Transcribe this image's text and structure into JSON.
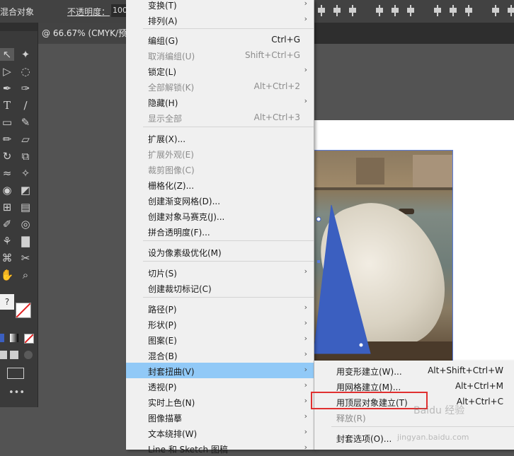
{
  "control_bar": {
    "blend_label": "混合对象",
    "opacity_label": "不透明度：",
    "opacity_value": "100"
  },
  "document_tab": {
    "title": "@ 66.67% (CMYK/预"
  },
  "object_menu": {
    "items": [
      {
        "label": "变换(T)",
        "shortcut": "",
        "submenu": true,
        "disabled": false
      },
      {
        "label": "排列(A)",
        "shortcut": "",
        "submenu": true,
        "disabled": false
      },
      {
        "label": "编组(G)",
        "shortcut": "Ctrl+G",
        "submenu": false,
        "disabled": false
      },
      {
        "label": "取消编组(U)",
        "shortcut": "Shift+Ctrl+G",
        "submenu": false,
        "disabled": true
      },
      {
        "label": "锁定(L)",
        "shortcut": "",
        "submenu": true,
        "disabled": false
      },
      {
        "label": "全部解锁(K)",
        "shortcut": "Alt+Ctrl+2",
        "submenu": false,
        "disabled": true
      },
      {
        "label": "隐藏(H)",
        "shortcut": "",
        "submenu": true,
        "disabled": false
      },
      {
        "label": "显示全部",
        "shortcut": "Alt+Ctrl+3",
        "submenu": false,
        "disabled": true
      },
      {
        "label": "扩展(X)...",
        "shortcut": "",
        "submenu": false,
        "disabled": false
      },
      {
        "label": "扩展外观(E)",
        "shortcut": "",
        "submenu": false,
        "disabled": true
      },
      {
        "label": "裁剪图像(C)",
        "shortcut": "",
        "submenu": false,
        "disabled": true
      },
      {
        "label": "栅格化(Z)...",
        "shortcut": "",
        "submenu": false,
        "disabled": false
      },
      {
        "label": "创建渐变网格(D)...",
        "shortcut": "",
        "submenu": false,
        "disabled": false
      },
      {
        "label": "创建对象马赛克(J)...",
        "shortcut": "",
        "submenu": false,
        "disabled": false
      },
      {
        "label": "拼合透明度(F)...",
        "shortcut": "",
        "submenu": false,
        "disabled": false
      },
      {
        "label": "设为像素级优化(M)",
        "shortcut": "",
        "submenu": false,
        "disabled": false
      },
      {
        "label": "切片(S)",
        "shortcut": "",
        "submenu": true,
        "disabled": false
      },
      {
        "label": "创建裁切标记(C)",
        "shortcut": "",
        "submenu": false,
        "disabled": false
      },
      {
        "label": "路径(P)",
        "shortcut": "",
        "submenu": true,
        "disabled": false
      },
      {
        "label": "形状(P)",
        "shortcut": "",
        "submenu": true,
        "disabled": false
      },
      {
        "label": "图案(E)",
        "shortcut": "",
        "submenu": true,
        "disabled": false
      },
      {
        "label": "混合(B)",
        "shortcut": "",
        "submenu": true,
        "disabled": false
      },
      {
        "label": "封套扭曲(V)",
        "shortcut": "",
        "submenu": true,
        "disabled": false,
        "highlighted": true
      },
      {
        "label": "透视(P)",
        "shortcut": "",
        "submenu": true,
        "disabled": false
      },
      {
        "label": "实时上色(N)",
        "shortcut": "",
        "submenu": true,
        "disabled": false
      },
      {
        "label": "图像描摹",
        "shortcut": "",
        "submenu": true,
        "disabled": false
      },
      {
        "label": "文本绕排(W)",
        "shortcut": "",
        "submenu": true,
        "disabled": false
      },
      {
        "label": "Line 和 Sketch 图稿",
        "shortcut": "",
        "submenu": true,
        "disabled": false
      }
    ]
  },
  "envelope_submenu": {
    "items": [
      {
        "label": "用变形建立(W)...",
        "shortcut": "Alt+Shift+Ctrl+W",
        "disabled": false
      },
      {
        "label": "用网格建立(M)...",
        "shortcut": "Alt+Ctrl+M",
        "disabled": false
      },
      {
        "label": "用顶层对象建立(T)",
        "shortcut": "Alt+Ctrl+C",
        "disabled": false,
        "boxed": true
      },
      {
        "label": "释放(R)",
        "shortcut": "",
        "disabled": true
      },
      {
        "label": "封套选项(O)...",
        "shortcut": "",
        "disabled": false
      }
    ]
  },
  "watermark": {
    "text": "Baidu 经验",
    "url": "jingyan.baidu.com"
  },
  "colors": {
    "menu_highlight": "#91c9f7",
    "annotation_box": "#e03030",
    "selection_blue": "#3b5fc0"
  }
}
